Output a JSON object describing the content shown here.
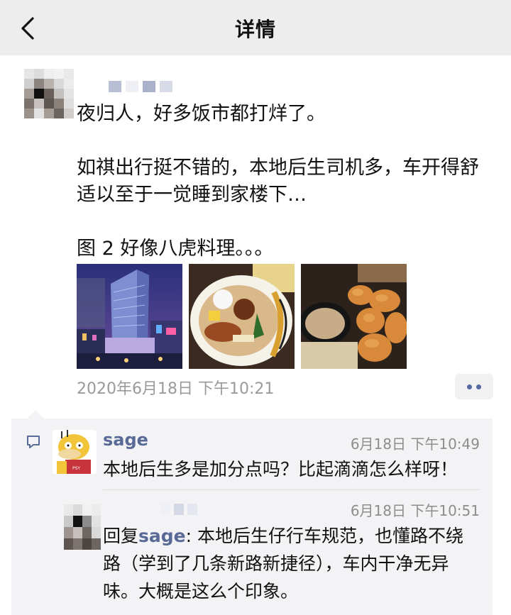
{
  "nav": {
    "title": "详情",
    "back_icon": "chevron-left-icon"
  },
  "post": {
    "paragraphs": [
      "夜归人，好多饭市都打烊了。",
      "如祺出行挺不错的，本地后生司机多，车开得舒适以至于一觉睡到家楼下…",
      "图 2 好像八虎料理。。。"
    ],
    "photos": [
      {
        "name": "photo-city-night-building"
      },
      {
        "name": "photo-ramen-bowl"
      },
      {
        "name": "photo-fried-food"
      }
    ],
    "timestamp": "2020年6月18日 下午10:21",
    "more_icon": "more-dots-icon"
  },
  "comments": [
    {
      "author": "sage",
      "time": "6月18日 下午10:49",
      "text": "本地后生多是加分点吗？比起滴滴怎么样呀！"
    },
    {
      "time": "6月18日 下午10:51",
      "reply_prefix": "回复",
      "reply_to": "sage",
      "text_lines": [
        ": 本地后生仔行车规范，也懂路不绕",
        "路（学到了几条新路新捷径），车内干净无异",
        "味。大概是这么个印象。"
      ]
    }
  ],
  "colors": {
    "link": "#596a97",
    "nav_bg": "#ededed",
    "comments_bg": "#f3f3f5",
    "meta_text": "#9a9a9a"
  }
}
